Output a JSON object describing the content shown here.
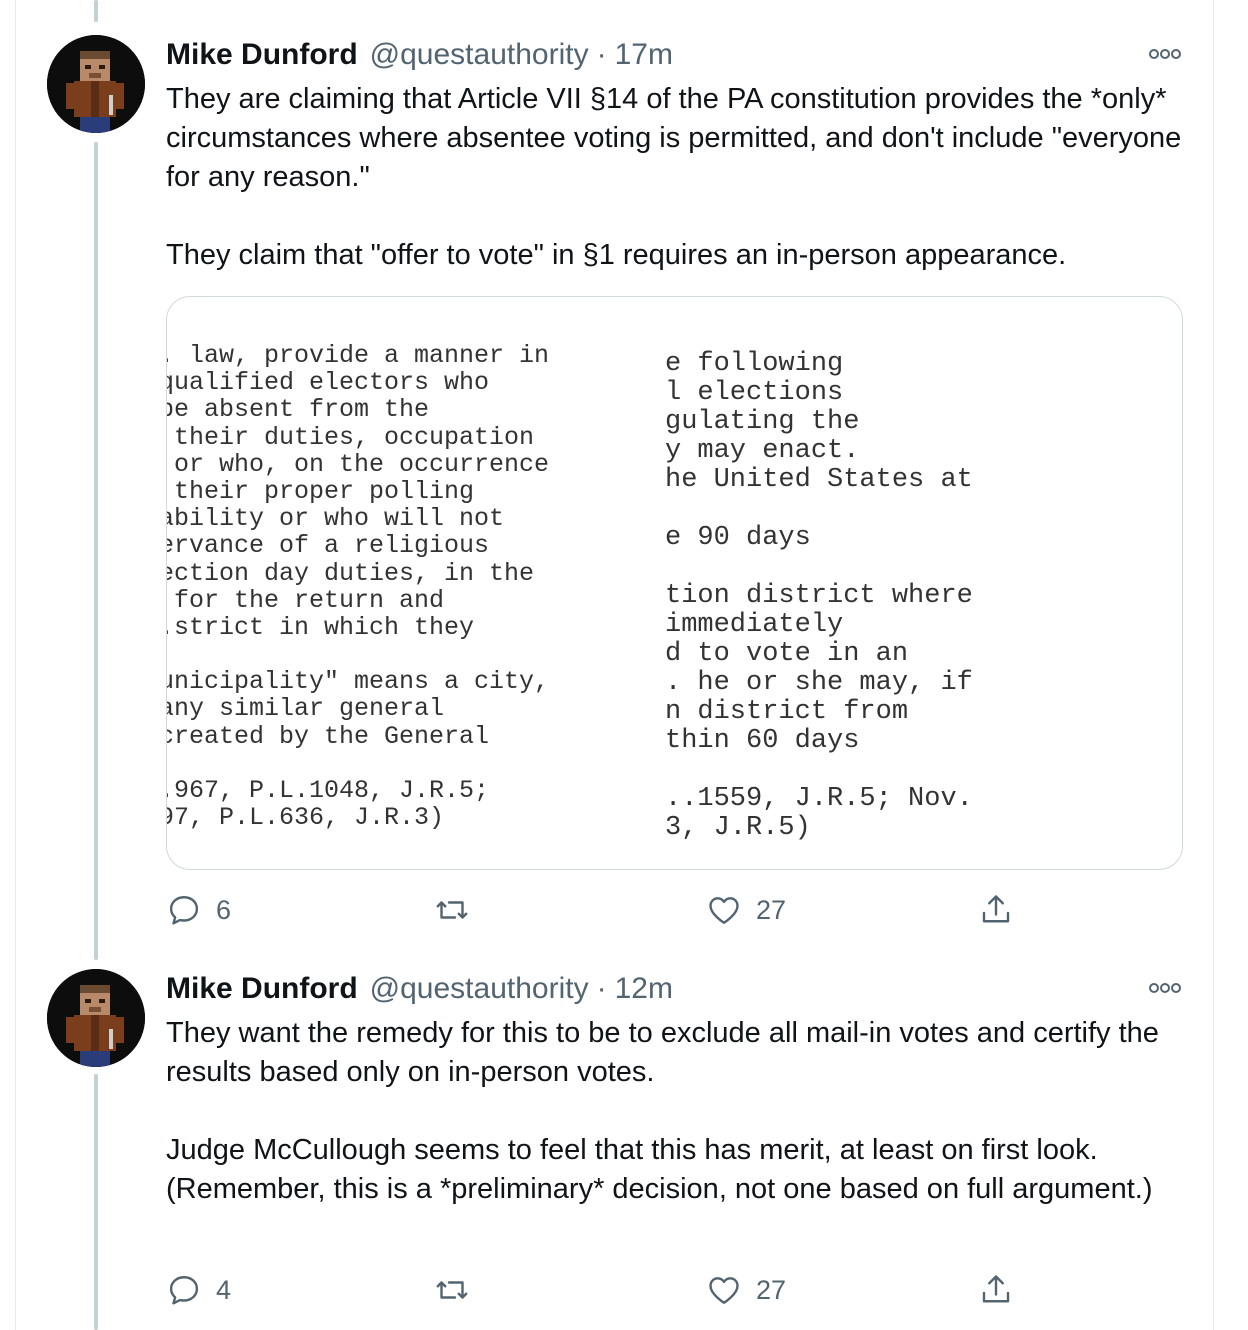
{
  "tweets": [
    {
      "author_name": "Mike Dunford",
      "handle": "@questauthority",
      "separator": "·",
      "time": "17m",
      "paragraphs": [
        "They are claiming that Article VII §14 of the PA constitution provides the *only* circumstances where absentee voting is permitted, and don't include \"everyone for any reason.\"",
        "They claim that \"offer to vote\" in §1 requires an in-person appearance."
      ],
      "media": {
        "left_lines": [
          ". law, provide a manner in",
          "qualified electors who",
          "be absent from the",
          " their duties, occupation",
          " or who, on the occurrence",
          " their proper polling",
          "ability or who will not",
          "ervance of a religious",
          "ection day duties, in the",
          " for the return and",
          ".strict in which they",
          "",
          "unicipality\" means a city,",
          "any similar general",
          "created by the General",
          "",
          ".967, P.L.1048, J.R.5;",
          "97, P.L.636, J.R.3)"
        ],
        "right_lines": [
          "e following",
          "l elections",
          "gulating the",
          "y may enact.",
          "he United States at",
          "",
          "e 90 days",
          "",
          "tion district where",
          "immediately",
          "d to vote in an",
          ". he or she may, if",
          "n district from",
          "thin 60 days",
          "",
          "..1559, J.R.5; Nov.",
          "3, J.R.5)"
        ]
      },
      "replies": "6",
      "retweets": "",
      "likes": "27"
    },
    {
      "author_name": "Mike Dunford",
      "handle": "@questauthority",
      "separator": "·",
      "time": "12m",
      "paragraphs": [
        "They want the remedy for this to be to exclude all mail-in votes and certify the results based only on in-person votes.",
        "Judge McCullough seems to feel that this has merit, at least on first look. (Remember, this is a *preliminary* decision, not one based on full argument.)"
      ],
      "replies": "4",
      "retweets": "",
      "likes": "27"
    }
  ],
  "icons": {
    "reply": "reply-icon",
    "retweet": "retweet-icon",
    "like": "like-icon",
    "share": "share-icon",
    "more": "more-icon"
  },
  "colors": {
    "text": "#0f1419",
    "secondary": "#536471",
    "thread_line": "#c4cfd6",
    "border": "#cfd9de"
  }
}
